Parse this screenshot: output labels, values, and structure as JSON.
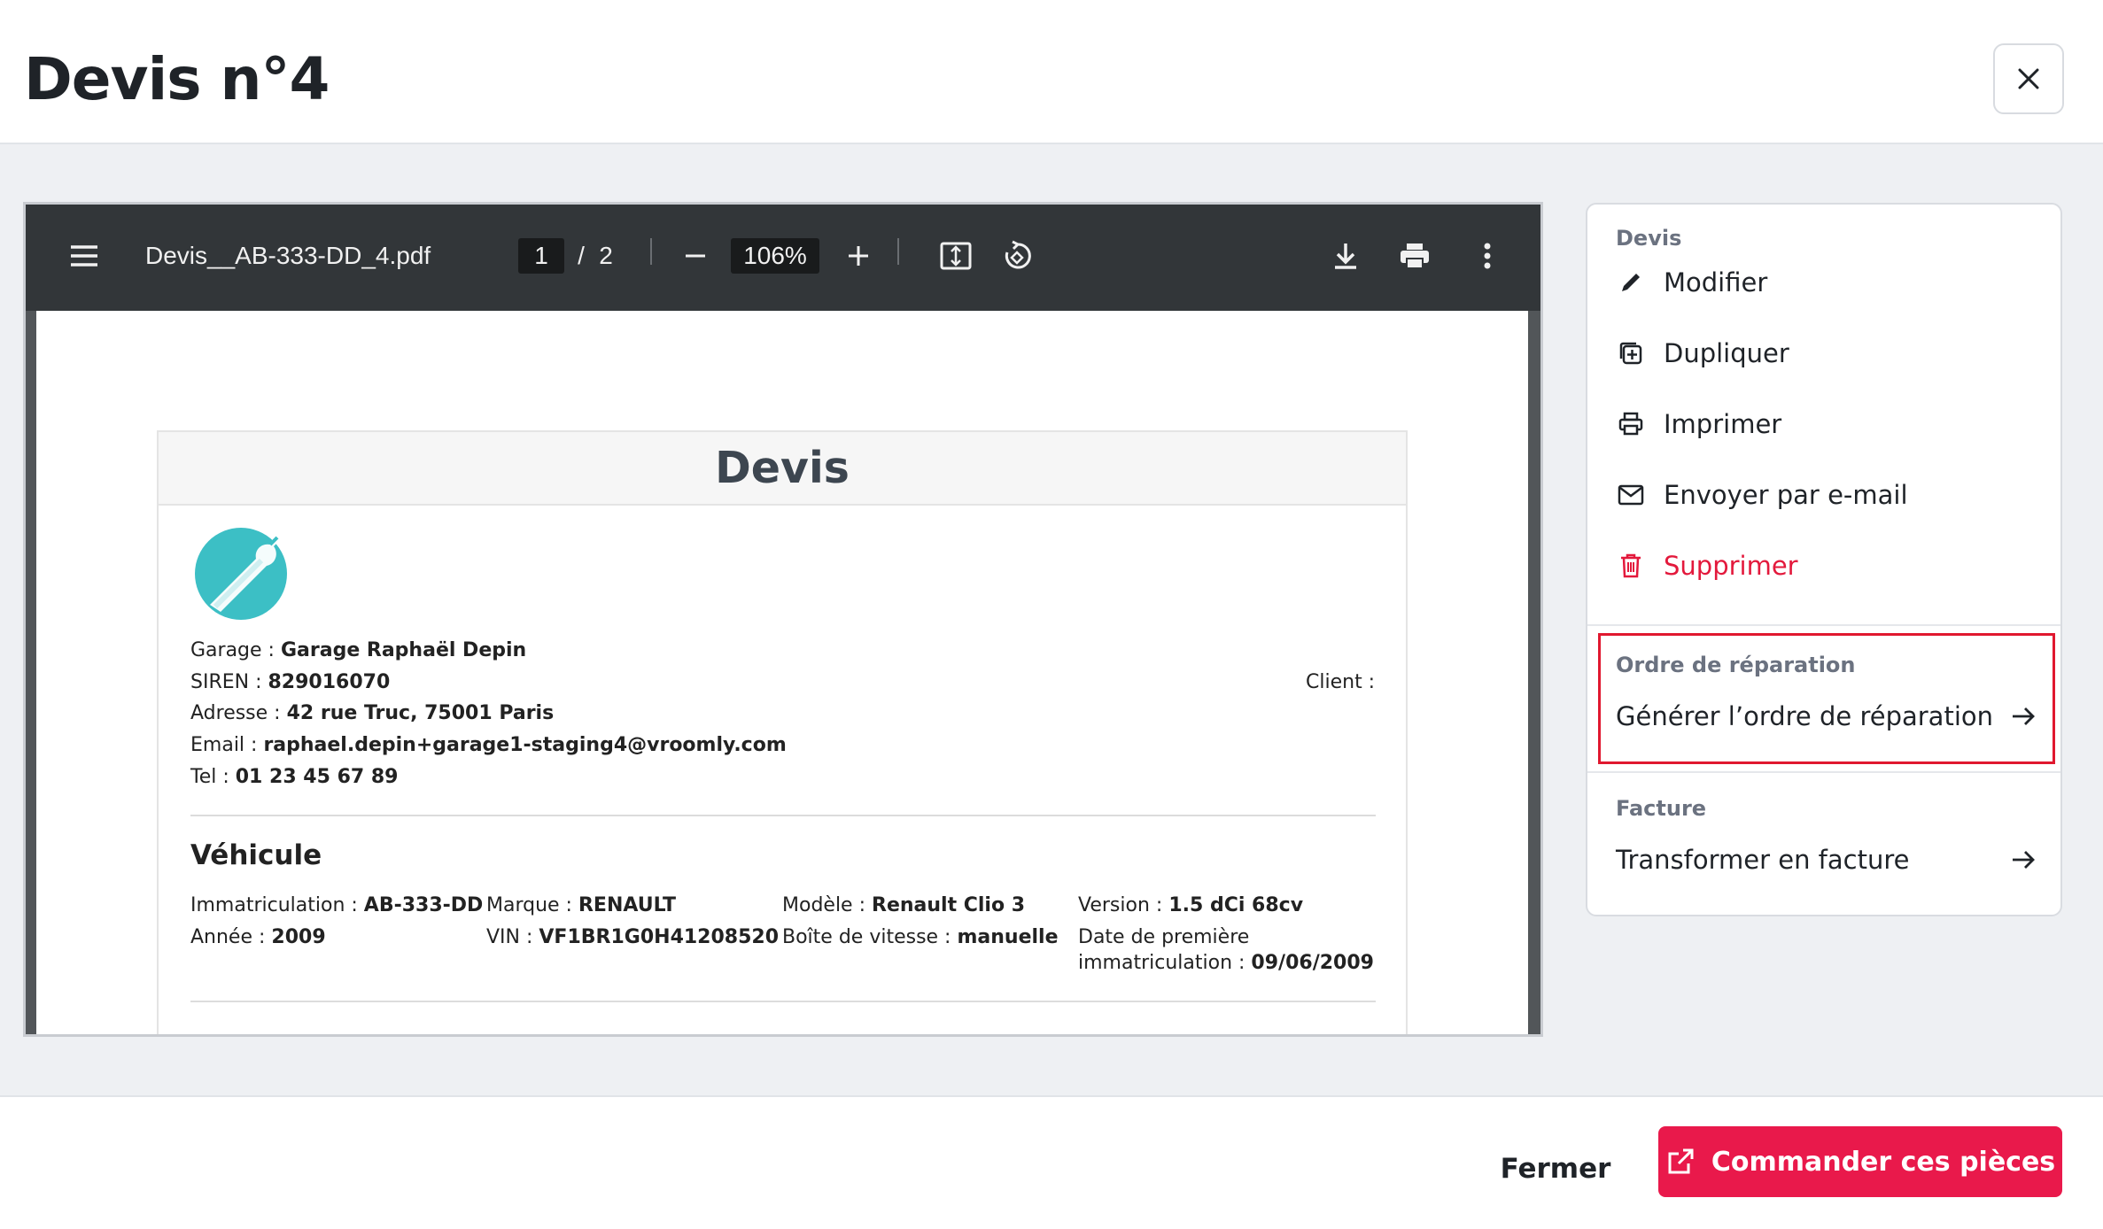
{
  "modal": {
    "title": "Devis n°4",
    "close_icon": "close-icon"
  },
  "viewer": {
    "filename": "Devis__AB-333-DD_4.pdf",
    "page_current": "1",
    "page_separator": "/",
    "page_total": "2",
    "zoom": "106%",
    "icons": [
      "menu-icon",
      "zoom-out-icon",
      "zoom-in-icon",
      "fit-page-icon",
      "rotate-icon",
      "download-icon",
      "print-icon",
      "more-vert-icon"
    ]
  },
  "document": {
    "heading": "Devis",
    "garage": {
      "garage_label": "Garage : ",
      "garage_value": "Garage Raphaël Depin",
      "siren_label": "SIREN : ",
      "siren_value": "829016070",
      "address_label": "Adresse : ",
      "address_value": "42 rue Truc, 75001 Paris",
      "email_label": "Email : ",
      "email_value": "raphael.depin+garage1-staging4@vroomly.com",
      "tel_label": "Tel : ",
      "tel_value": "01 23 45 67 89"
    },
    "client_label": "Client :",
    "vehicle": {
      "section_title": "Véhicule",
      "immat_label": "Immatriculation : ",
      "immat_value": "AB-333-DD",
      "marque_label": "Marque : ",
      "marque_value": "RENAULT",
      "modele_label": "Modèle : ",
      "modele_value": "Renault Clio 3",
      "version_label": "Version : ",
      "version_value": "1.5 dCi 68cv",
      "annee_label": "Année : ",
      "annee_value": "2009",
      "vin_label": "VIN : ",
      "vin_value": "VF1BR1G0H41208520",
      "boite_label": "Boîte de vitesse : ",
      "boite_value": "manuelle",
      "date_label_1": "Date de première",
      "date_label_2": "immatriculation : ",
      "date_value": "09/06/2009"
    }
  },
  "panel": {
    "devis": {
      "title": "Devis",
      "items": [
        {
          "label": "Modifier",
          "icon": "pencil-icon"
        },
        {
          "label": "Dupliquer",
          "icon": "duplicate-icon"
        },
        {
          "label": "Imprimer",
          "icon": "printer-icon"
        },
        {
          "label": "Envoyer par e-mail",
          "icon": "mail-icon"
        },
        {
          "label": "Supprimer",
          "icon": "trash-icon"
        }
      ]
    },
    "ordre": {
      "title": "Ordre de réparation",
      "action": "Générer l’ordre de réparation"
    },
    "facture": {
      "title": "Facture",
      "action": "Transformer en facture"
    }
  },
  "footer": {
    "close_label": "Fermer",
    "order_label": "Commander ces pièces"
  },
  "colors": {
    "accent": "#e9194b",
    "danger": "#e3193c",
    "highlight": "#e0182f",
    "logo": "#3cbfc5"
  }
}
